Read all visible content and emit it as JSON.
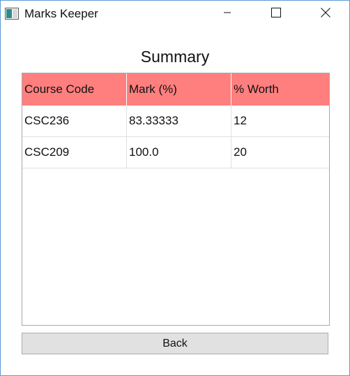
{
  "window": {
    "title": "Marks Keeper",
    "icon": "app-window-icon",
    "controls": [
      "minimize-icon",
      "maximize-icon",
      "close-icon"
    ]
  },
  "main": {
    "heading": "Summary",
    "table": {
      "columns": [
        "Course Code",
        "Mark (%)",
        "% Worth"
      ],
      "rows": [
        [
          "CSC236",
          "83.33333",
          "12"
        ],
        [
          "CSC209",
          "100.0",
          "20"
        ]
      ],
      "header_color": "#ff7f7f"
    },
    "back_label": "Back"
  }
}
